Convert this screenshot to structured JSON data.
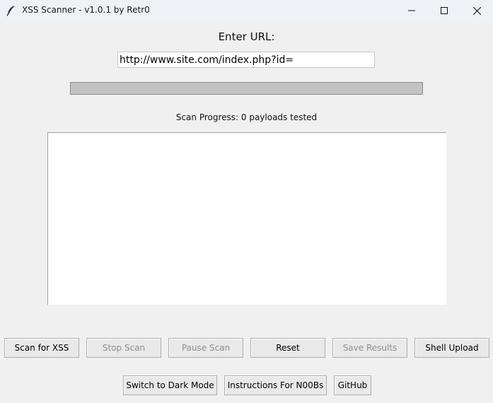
{
  "window": {
    "title": "XSS Scanner - v1.0.1 by Retr0",
    "app_icon": "feather-icon",
    "controls": [
      "minimize-icon",
      "maximize-icon",
      "close-icon"
    ]
  },
  "url_section": {
    "label": "Enter URL:",
    "value": "http://www.site.com/index.php?id="
  },
  "progress": {
    "value": 0,
    "text": "Scan Progress: 0 payloads tested"
  },
  "results": {
    "text": ""
  },
  "buttons_row1": [
    {
      "label": "Scan for XSS",
      "enabled": true
    },
    {
      "label": "Stop Scan",
      "enabled": false
    },
    {
      "label": "Pause Scan",
      "enabled": false
    },
    {
      "label": "Reset",
      "enabled": true
    },
    {
      "label": "Save Results",
      "enabled": false
    },
    {
      "label": "Shell Upload",
      "enabled": true
    }
  ],
  "buttons_row2": [
    {
      "label": "Switch to Dark Mode",
      "enabled": true
    },
    {
      "label": "Instructions For N00Bs",
      "enabled": true
    },
    {
      "label": "GitHub",
      "enabled": true
    }
  ],
  "colors": {
    "window_bg": "#f0f0f0",
    "titlebar_bg": "#eef1f6",
    "progress_trough": "#c3c3c3",
    "disabled_text": "#8d8d8d"
  }
}
